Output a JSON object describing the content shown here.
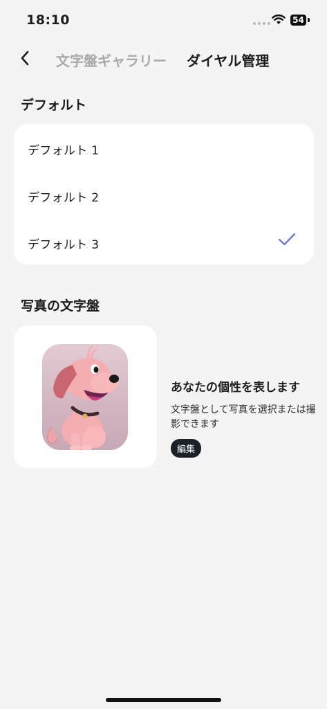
{
  "status_bar": {
    "time": "18:10",
    "battery": "54"
  },
  "nav": {
    "tabs": [
      {
        "label": "文字盤ギャラリー",
        "active": false
      },
      {
        "label": "ダイヤル管理",
        "active": true
      }
    ]
  },
  "default_section": {
    "title": "デフォルト",
    "items": [
      {
        "label": "デフォルト 1",
        "selected": false
      },
      {
        "label": "デフォルト 2",
        "selected": false
      },
      {
        "label": "デフォルト 3",
        "selected": true
      }
    ]
  },
  "photo_section": {
    "title": "写真の文字盤",
    "heading": "あなたの個性を表します",
    "description": "文字盤として写真を選択または撮影できます",
    "edit_label": "編集"
  },
  "colors": {
    "background": "#f4f4f4",
    "card": "#ffffff",
    "check": "#5b6ee1",
    "inactive_tab": "#a9a9ab",
    "edit_button": "#1b2029"
  }
}
